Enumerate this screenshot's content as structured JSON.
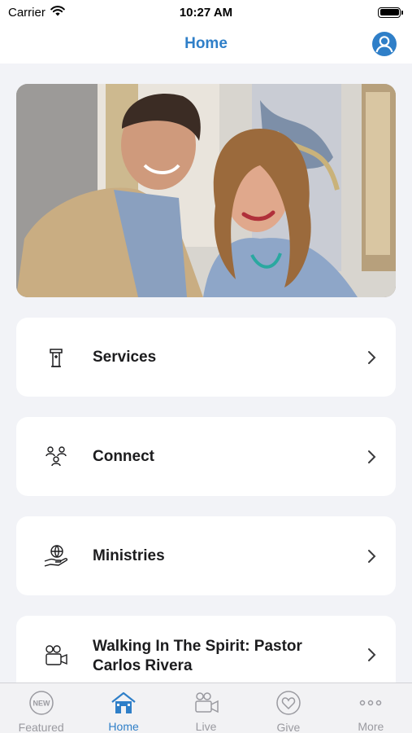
{
  "status_bar": {
    "carrier": "Carrier",
    "time": "10:27 AM",
    "battery_level": 1.0
  },
  "nav": {
    "title": "Home",
    "profile_icon": "user-circle-icon"
  },
  "hero": {
    "description_icon": "photo"
  },
  "menu": [
    {
      "label": "Services",
      "icon": "podium-icon"
    },
    {
      "label": "Connect",
      "icon": "people-icon"
    },
    {
      "label": "Ministries",
      "icon": "hand-globe-icon"
    },
    {
      "label": "Walking In The Spirit: Pastor Carlos Rivera",
      "icon": "video-camera-icon"
    }
  ],
  "tabs": [
    {
      "label": "Featured",
      "icon": "new-badge-icon",
      "active": false
    },
    {
      "label": "Home",
      "icon": "house-icon",
      "active": true
    },
    {
      "label": "Live",
      "icon": "video-camera-icon",
      "active": false
    },
    {
      "label": "Give",
      "icon": "heart-circle-icon",
      "active": false
    },
    {
      "label": "More",
      "icon": "ellipsis-icon",
      "active": false
    }
  ],
  "featured_badge_text": "NEW",
  "colors": {
    "accent": "#2f7fc8",
    "background": "#f2f3f7",
    "card": "#ffffff",
    "tab_inactive": "#9a9aa0"
  }
}
